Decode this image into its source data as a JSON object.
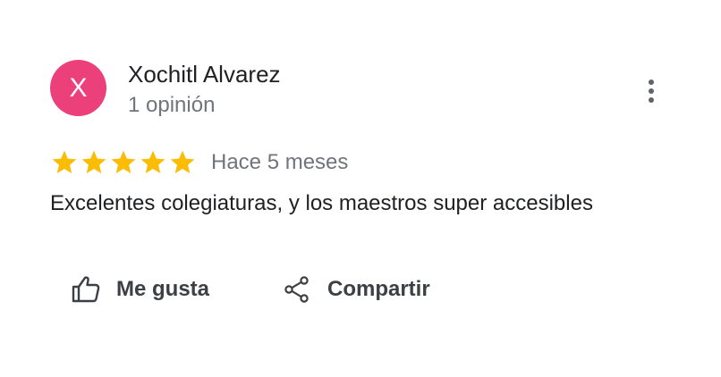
{
  "review": {
    "avatar_initial": "X",
    "author_name": "Xochitl Alvarez",
    "review_count": "1 opinión",
    "rating": 5,
    "rating_max": 5,
    "date": "Hace 5 meses",
    "text": "Excelentes colegiaturas, y los maestros super accesibles"
  },
  "actions": {
    "like_label": "Me gusta",
    "share_label": "Compartir"
  },
  "icons": {
    "more": "more-vert-icon",
    "star": "star-icon",
    "like": "thumb-up-icon",
    "share": "share-icon"
  },
  "colors": {
    "avatar_bg": "#ec407a",
    "star": "#fbbc04",
    "secondary_text": "#70757a",
    "primary_text": "#202124"
  }
}
